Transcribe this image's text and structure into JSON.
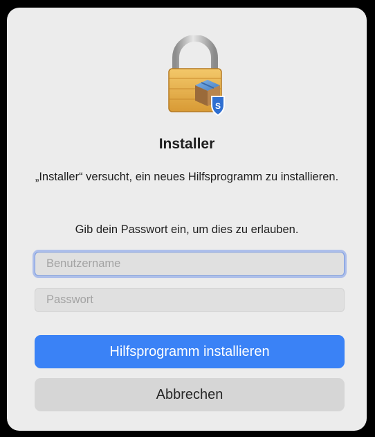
{
  "dialog": {
    "title": "Installer",
    "message": "„Installer“ versucht, ein neues Hilfsprogramm zu installieren.",
    "prompt": "Gib dein Passwort ein, um dies zu erlauben.",
    "username_placeholder": "Benutzername",
    "username_value": "",
    "password_placeholder": "Passwort",
    "password_value": "",
    "install_button_label": "Hilfsprogramm installieren",
    "cancel_button_label": "Abbrechen",
    "icon": "lock-package-icon",
    "badge_text": "S"
  },
  "colors": {
    "accent": "#3a82f6",
    "dialog_background": "#ececec",
    "focus_ring": "#aebfea"
  }
}
